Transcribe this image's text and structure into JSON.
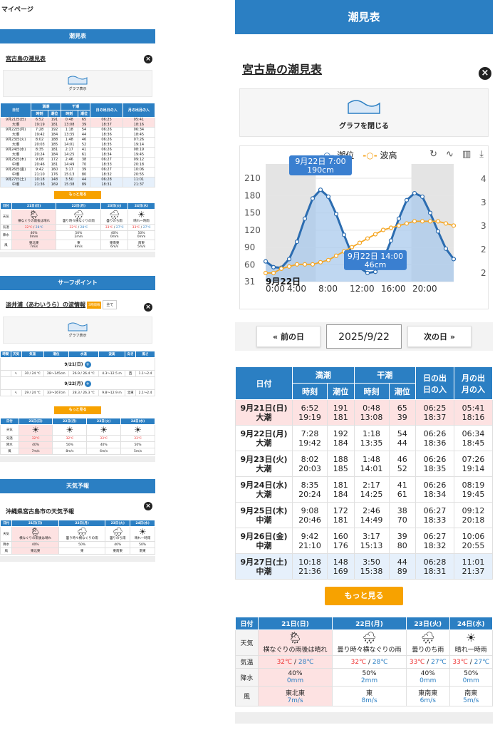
{
  "left": {
    "mypage": "マイページ",
    "tide_header": "潮見表",
    "tide_title": "宮古島の潮見表",
    "graph_label": "グラフ表示",
    "tide_cols": {
      "date": "日付",
      "high": "満潮",
      "low": "干潮",
      "time": "時刻",
      "level": "潮位",
      "sun": "日の出日の入",
      "moon": "月の出月の入"
    },
    "tide_rows": [
      {
        "date": "9月21日(日)",
        "type": "大潮",
        "h1": "6:52",
        "h2": "19:19",
        "hl1": "191",
        "hl2": "181",
        "l1": "0:48",
        "l2": "13:08",
        "ll1": "65",
        "ll2": "39",
        "s1": "06:25",
        "s2": "18:37",
        "m1": "05:41",
        "m2": "18:16"
      },
      {
        "date": "9月22日(月)",
        "type": "大潮",
        "h1": "7:28",
        "h2": "19:42",
        "hl1": "192",
        "hl2": "184",
        "l1": "1:18",
        "l2": "13:35",
        "ll1": "54",
        "ll2": "44",
        "s1": "06:26",
        "s2": "18:36",
        "m1": "06:34",
        "m2": "18:45"
      },
      {
        "date": "9月23日(火)",
        "type": "大潮",
        "h1": "8:02",
        "h2": "20:03",
        "hl1": "188",
        "hl2": "185",
        "l1": "1:48",
        "l2": "14:01",
        "ll1": "46",
        "ll2": "52",
        "s1": "06:26",
        "s2": "18:35",
        "m1": "07:26",
        "m2": "19:14"
      },
      {
        "date": "9月24日(水)",
        "type": "大潮",
        "h1": "8:35",
        "h2": "20:24",
        "hl1": "181",
        "hl2": "184",
        "l1": "2:17",
        "l2": "14:25",
        "ll1": "41",
        "ll2": "61",
        "s1": "06:26",
        "s2": "18:34",
        "m1": "08:19",
        "m2": "19:45"
      },
      {
        "date": "9月25日(木)",
        "type": "中潮",
        "h1": "9:08",
        "h2": "20:46",
        "hl1": "172",
        "hl2": "181",
        "l1": "2:46",
        "l2": "14:49",
        "ll1": "38",
        "ll2": "70",
        "s1": "06:27",
        "s2": "18:33",
        "m1": "09:12",
        "m2": "20:18"
      },
      {
        "date": "9月26日(金)",
        "type": "中潮",
        "h1": "9:42",
        "h2": "21:10",
        "hl1": "160",
        "hl2": "176",
        "l1": "3:17",
        "l2": "15:13",
        "ll1": "39",
        "ll2": "80",
        "s1": "06:27",
        "s2": "18:32",
        "m1": "10:06",
        "m2": "20:55"
      },
      {
        "date": "9月27日(土)",
        "type": "中潮",
        "h1": "10:18",
        "h2": "21:36",
        "hl1": "148",
        "hl2": "169",
        "l1": "3:50",
        "l2": "15:38",
        "ll1": "44",
        "ll2": "89",
        "s1": "06:28",
        "s2": "18:31",
        "m1": "11:01",
        "m2": "21:37"
      }
    ],
    "more": "もっと見る",
    "surf_header": "サーフポイント",
    "surf_title": "淡井浦（あわいうら）の波情報",
    "surf_tab1": "3時間毎",
    "surf_tab2": "全て",
    "surf_cols": {
      "time": "時間",
      "wx": "天気",
      "temp": "気温",
      "tide": "潮位",
      "water": "水温",
      "wave": "波高",
      "wind": "風",
      "dir": "向き",
      "speed": "風さ"
    },
    "surf_day1": "9/21(日)",
    "surf_day2": "9/22(月)",
    "surf_row1": {
      "temp": "30 / 24 ℃",
      "tide": "28〜145cm",
      "water": "26.9 / 26.4 ℃",
      "wave": "4.3〜12.5 m",
      "dir": "西",
      "sp": "1.1〜2.4"
    },
    "surf_row2": {
      "temp": "29 / 24 ℃",
      "tide": "33〜167cm",
      "water": "28.3 / 26.3 ℃",
      "wave": "9.8〜12.9 m",
      "dir": "北東",
      "sp": "2.1〜2.4"
    },
    "forecast_header": "天気予報",
    "forecast_title": "沖縄県宮古島市の天気予報"
  },
  "right": {
    "header": "潮見表",
    "title": "宮古島の潮見表",
    "graph_close": "グラフを閉じる",
    "legend_tide": "潮位",
    "legend_wave": "波高",
    "prev": "« 前の日",
    "date": "2025/9/22",
    "next": "次の日 »",
    "more": "もっと見る"
  },
  "tide_cols": {
    "date": "日付",
    "high": "満潮",
    "low": "干潮",
    "time": "時刻",
    "level": "潮位",
    "sun1": "日の出",
    "sun2": "日の入",
    "moon1": "月の出",
    "moon2": "月の入"
  },
  "weather": {
    "row_labels": {
      "day": "日付",
      "wx": "天気",
      "temp": "気温",
      "rain": "降水",
      "wind": "風"
    },
    "days": [
      {
        "d": "21日(日)",
        "icon": "rain-sun-icon",
        "desc": "横なぐりの雨後は晴れ",
        "hi": "32℃",
        "lo": "28℃",
        "rain1": "40%",
        "rain2": "0mm",
        "wd": "東北東",
        "ws": "7m/s"
      },
      {
        "d": "22日(月)",
        "icon": "cloud-rain-icon",
        "desc": "曇り時々横なぐりの雨",
        "hi": "32℃",
        "lo": "28℃",
        "rain1": "50%",
        "rain2": "2mm",
        "wd": "東",
        "ws": "8m/s"
      },
      {
        "d": "23日(火)",
        "icon": "cloud-rain-icon",
        "desc": "曇りのち雨",
        "hi": "33℃",
        "lo": "27℃",
        "rain1": "40%",
        "rain2": "0mm",
        "wd": "東南東",
        "ws": "6m/s"
      },
      {
        "d": "24日(水)",
        "icon": "sun-icon",
        "desc": "晴れ一時雨",
        "hi": "33℃",
        "lo": "27℃",
        "rain1": "50%",
        "rain2": "0mm",
        "wd": "南東",
        "ws": "5m/s"
      }
    ]
  },
  "chart_data": {
    "type": "line",
    "x_ticks": [
      "0:00",
      "4:00",
      "8:00",
      "12:00",
      "16:00",
      "20:00"
    ],
    "date_label": "9月22日",
    "yleft_ticks": [
      31,
      60,
      90,
      120,
      150,
      180,
      210
    ],
    "yright_ticks": [
      "2",
      "2",
      "3",
      "3",
      "4"
    ],
    "ylim": [
      31,
      210
    ],
    "series": [
      {
        "name": "潮位",
        "x": [
          0,
          1,
          2,
          3,
          4,
          5,
          6,
          7,
          8,
          9,
          10,
          11,
          12,
          13,
          14,
          15,
          16,
          17,
          18,
          19,
          20,
          21,
          22,
          23,
          24
        ],
        "values": [
          66,
          56,
          55,
          70,
          100,
          140,
          175,
          190,
          178,
          148,
          112,
          78,
          55,
          46,
          48,
          68,
          102,
          140,
          172,
          184,
          178,
          150,
          118,
          88,
          70
        ]
      },
      {
        "name": "波高",
        "values": [
          2.1,
          2.1,
          2.2,
          2.25,
          2.3,
          2.3,
          2.3,
          2.35,
          2.4,
          2.5,
          2.6,
          2.7,
          2.8,
          2.9,
          3.0,
          3.1,
          3.15,
          3.2,
          3.25,
          3.3,
          3.3,
          3.3,
          3.3,
          3.25,
          3.2
        ]
      }
    ],
    "annotations": [
      {
        "label": "9月22日 7:00",
        "value": "190cm"
      },
      {
        "label": "9月22日 14:00",
        "value": "46cm"
      }
    ]
  }
}
